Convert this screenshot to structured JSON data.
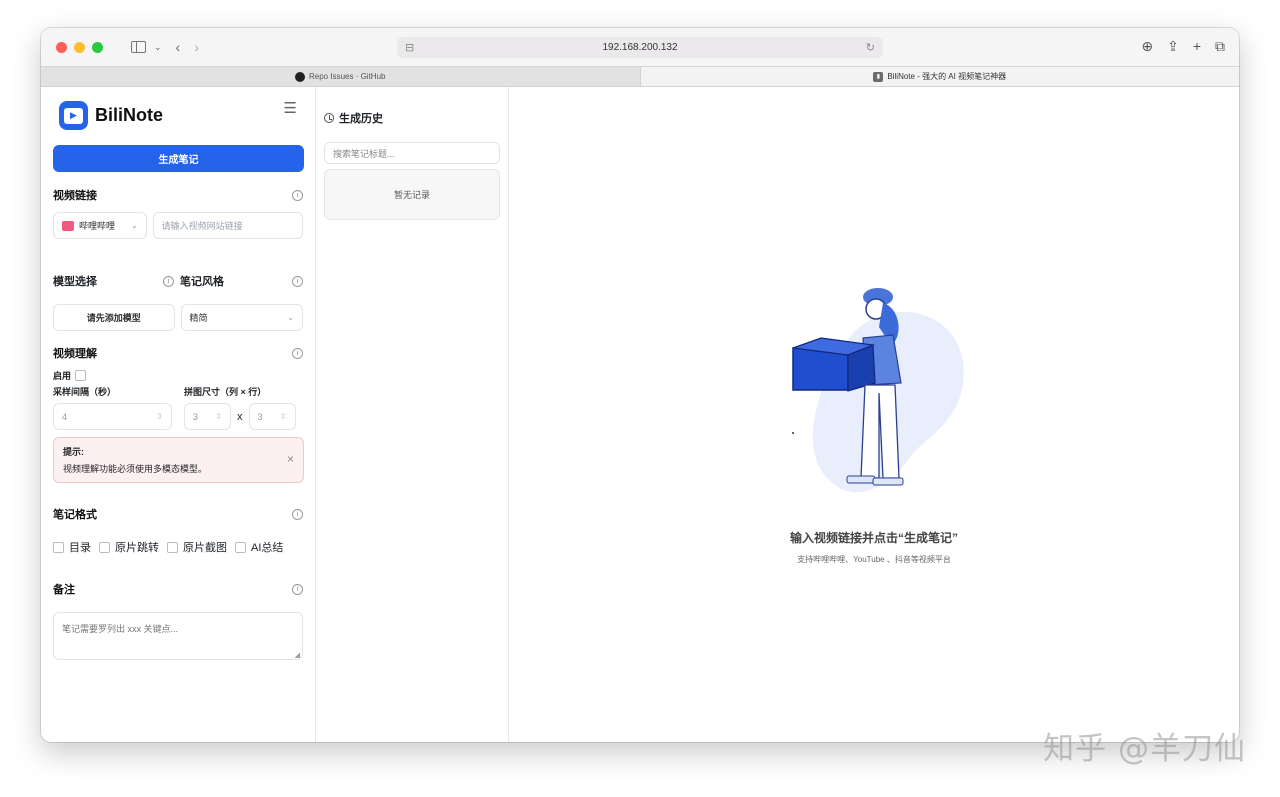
{
  "browser": {
    "address": "192.168.200.132",
    "tabs": [
      {
        "title": "Repo Issues · GitHub",
        "active": false
      },
      {
        "title": "BiliNote - 强大的 AI 视频笔记神器",
        "active": true
      }
    ]
  },
  "sidebar": {
    "brand": "BiliNote",
    "generate_button": "生成笔记",
    "video_link": {
      "label": "视频链接",
      "platform": "哔哩哔哩",
      "placeholder": "请输入视频网站链接"
    },
    "model": {
      "label": "模型选择",
      "button": "请先添加模型"
    },
    "note_style": {
      "label": "笔记风格",
      "value": "精简"
    },
    "video_understanding": {
      "label": "视频理解",
      "enable_label": "启用",
      "interval_label": "采样间隔（秒）",
      "interval_value": "4",
      "grid_label": "拼图尺寸（列 × 行）",
      "grid_cols": "3",
      "grid_x": "x",
      "grid_rows": "3"
    },
    "alert": {
      "title": "提示:",
      "text": "视频理解功能必须使用多模态模型。"
    },
    "note_format": {
      "label": "笔记格式",
      "options": [
        "目录",
        "原片跳转",
        "原片截图",
        "AI总结"
      ]
    },
    "remarks": {
      "label": "备注",
      "placeholder": "笔记需要罗列出 xxx 关键点..."
    }
  },
  "history": {
    "title": "生成历史",
    "search_placeholder": "搜索笔记标题...",
    "empty": "暂无记录"
  },
  "main": {
    "empty_title": "输入视频链接并点击“生成笔记”",
    "empty_subtitle": "支持哔哩哔哩、YouTube 、抖音等视频平台"
  },
  "watermark": "知乎 @羊刀仙",
  "colors": {
    "accent": "#2563eb",
    "alert_bg": "#fdf0f0"
  }
}
